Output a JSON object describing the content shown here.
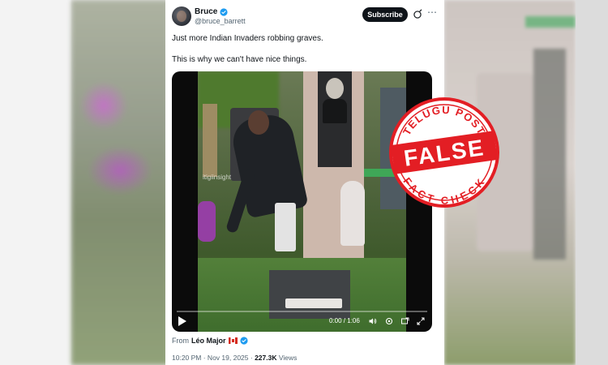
{
  "tweet": {
    "display_name": "Bruce",
    "handle": "@bruce_barrett",
    "subscribe_label": "Subscribe",
    "text_line1": "Just more Indian Invaders robbing graves.",
    "text_line2": "This is why we can't have nice things."
  },
  "video": {
    "watermark": "itigiinsight",
    "time": "0:00 / 1:06",
    "progress": 0
  },
  "footer": {
    "from_label": "From",
    "from_name": "Léo Major",
    "timestamp": "10:20 PM · Nov 19, 2025 · ",
    "views_count": "227.3K",
    "views_label": " Views"
  },
  "stamp": {
    "top_text": "TELUGU POST",
    "main_text": "FALSE",
    "bottom_text": "FACT CHECK"
  },
  "colors": {
    "verified_blue": "#1d9bf0",
    "stamp_red": "#e31e24"
  }
}
